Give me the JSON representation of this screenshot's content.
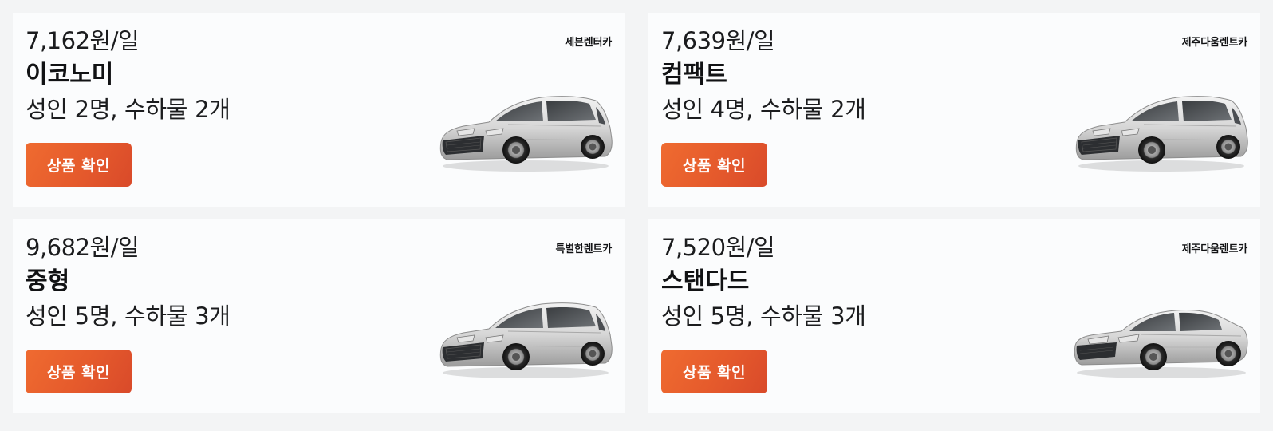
{
  "cards": [
    {
      "price": "7,162원/일",
      "class": "이코노미",
      "capacity": "성인 2명, 수하물 2개",
      "button_label": "상품 확인",
      "vendor": "세븐렌터카",
      "car_icon": "hatchback-car-icon"
    },
    {
      "price": "7,639원/일",
      "class": "컴팩트",
      "capacity": "성인 4명, 수하물 2개",
      "button_label": "상품 확인",
      "vendor": "제주다움렌트카",
      "car_icon": "hatchback-car-icon"
    },
    {
      "price": "9,682원/일",
      "class": "중형",
      "capacity": "성인 5명, 수하물 3개",
      "button_label": "상품 확인",
      "vendor": "특별한렌트카",
      "car_icon": "hatchback-car-icon"
    },
    {
      "price": "7,520원/일",
      "class": "스탠다드",
      "capacity": "성인 5명, 수하물 3개",
      "button_label": "상품 확인",
      "vendor": "제주다움렌트카",
      "car_icon": "sedan-car-icon"
    }
  ],
  "colors": {
    "button_start": "#ef6b30",
    "button_end": "#d94a2a",
    "card_bg": "#fbfcfd",
    "page_bg": "#f3f4f5"
  }
}
